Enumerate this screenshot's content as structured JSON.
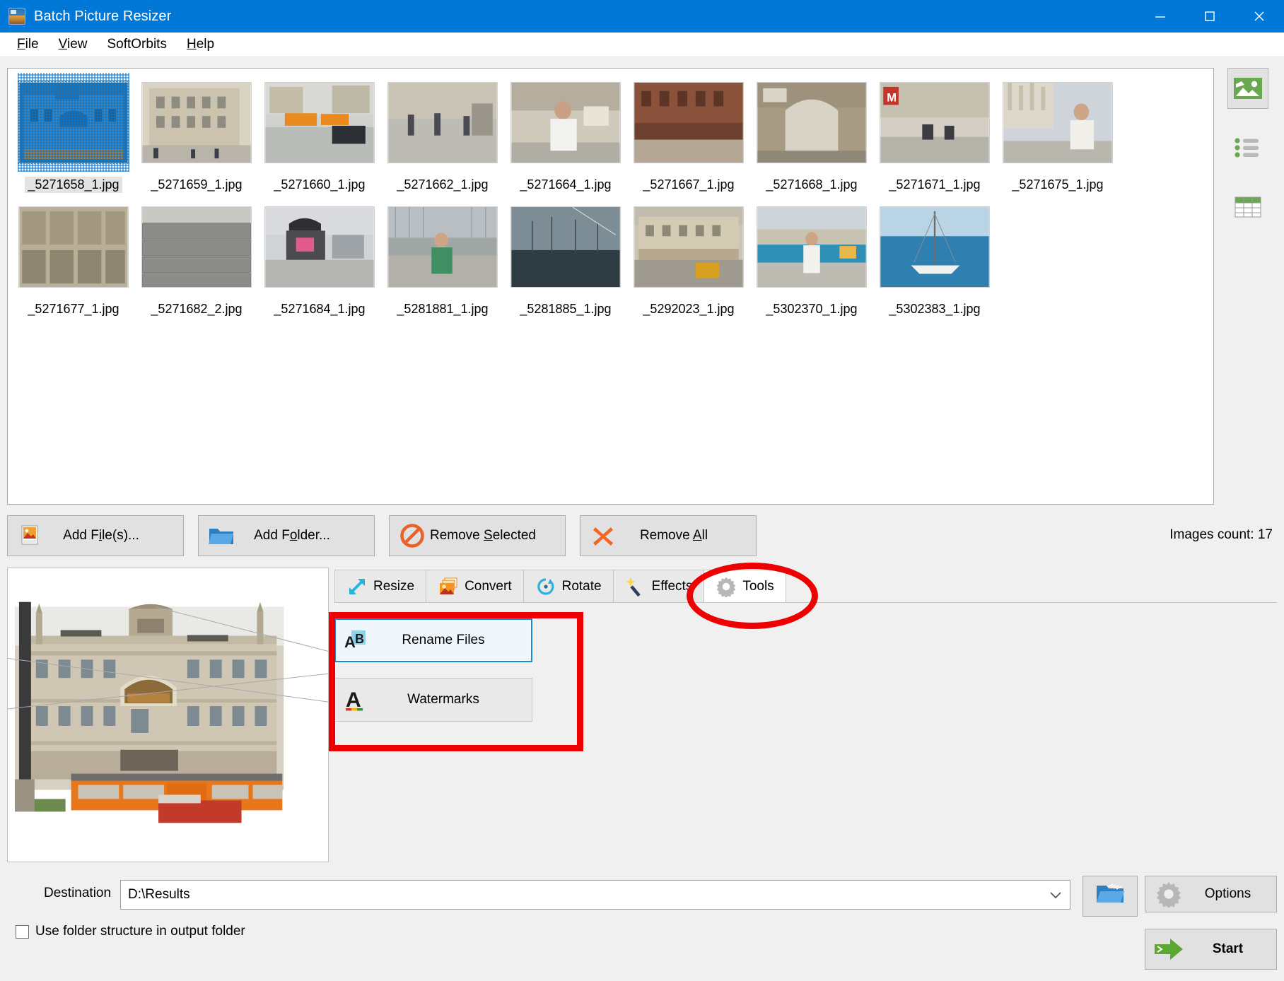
{
  "window": {
    "title": "Batch Picture Resizer",
    "icon": "app-icon",
    "controls": {
      "minimize": "–",
      "maximize": "□",
      "close": "✕"
    }
  },
  "menubar": {
    "items": [
      {
        "label": "File",
        "accel": "F"
      },
      {
        "label": "View",
        "accel": "V"
      },
      {
        "label": "SoftOrbits",
        "accel": ""
      },
      {
        "label": "Help",
        "accel": "H"
      }
    ]
  },
  "filelist": {
    "files": [
      {
        "name": "_5271658_1.jpg",
        "selected": true,
        "scene": "duomo-blue"
      },
      {
        "name": "_5271659_1.jpg",
        "selected": false,
        "scene": "corner-building"
      },
      {
        "name": "_5271660_1.jpg",
        "selected": false,
        "scene": "tram-square"
      },
      {
        "name": "_5271662_1.jpg",
        "selected": false,
        "scene": "street-people"
      },
      {
        "name": "_5271664_1.jpg",
        "selected": false,
        "scene": "man-market"
      },
      {
        "name": "_5271667_1.jpg",
        "selected": false,
        "scene": "brick-arcade"
      },
      {
        "name": "_5271668_1.jpg",
        "selected": false,
        "scene": "archway"
      },
      {
        "name": "_5271671_1.jpg",
        "selected": false,
        "scene": "metro-street"
      },
      {
        "name": "_5271675_1.jpg",
        "selected": false,
        "scene": "cathedral-man"
      },
      {
        "name": "_5271677_1.jpg",
        "selected": false,
        "scene": "stone-carving"
      },
      {
        "name": "_5271682_2.jpg",
        "selected": false,
        "scene": "grey-wall"
      },
      {
        "name": "_5271684_1.jpg",
        "selected": false,
        "scene": "car-trunk"
      },
      {
        "name": "_5281881_1.jpg",
        "selected": false,
        "scene": "harbor-man"
      },
      {
        "name": "_5281885_1.jpg",
        "selected": false,
        "scene": "dusk-masts"
      },
      {
        "name": "_5292023_1.jpg",
        "selected": false,
        "scene": "waterfront-bldg"
      },
      {
        "name": "_5302370_1.jpg",
        "selected": false,
        "scene": "promenade-woman"
      },
      {
        "name": "_5302383_1.jpg",
        "selected": false,
        "scene": "sailboat-sea"
      }
    ]
  },
  "viewmodes": {
    "items": [
      {
        "icon": "thumbnail-view-icon",
        "active": true
      },
      {
        "icon": "list-view-icon",
        "active": false
      },
      {
        "icon": "details-view-icon",
        "active": false
      }
    ]
  },
  "actions": {
    "add_files": "Add File(s)...",
    "add_files_accel": "i",
    "add_folder": "Add Folder...",
    "add_folder_accel": "o",
    "remove_selected": "Remove Selected",
    "remove_selected_accel": "S",
    "remove_all": "Remove All",
    "remove_all_accel": "A",
    "images_count": "Images count: 17"
  },
  "tabs": [
    {
      "label": "Resize",
      "icon": "resize-arrow-icon",
      "active": false
    },
    {
      "label": "Convert",
      "icon": "convert-images-icon",
      "active": false
    },
    {
      "label": "Rotate",
      "icon": "rotate-circle-icon",
      "active": false
    },
    {
      "label": "Effects",
      "icon": "magic-wand-icon",
      "active": false
    },
    {
      "label": "Tools",
      "icon": "gear-icon",
      "active": true
    }
  ],
  "tools_panel": {
    "buttons": [
      {
        "label": "Rename Files",
        "icon": "rename-ab-icon",
        "focused": true
      },
      {
        "label": "Watermarks",
        "icon": "watermark-a-icon",
        "focused": false
      }
    ]
  },
  "annotations": {
    "ellipse_target": "tools-tab",
    "rect_target": "tools-panel-buttons",
    "color": "#ef0000"
  },
  "bottom": {
    "destination_label": "Destination",
    "destination_value": "D:\\Results",
    "destination_placeholder": "D:\\Results",
    "browse_icon": "open-folder-icon",
    "options_label": "Options",
    "options_icon": "gear-icon",
    "start_label": "Start",
    "start_icon": "green-arrow-icon",
    "use_folder_structure_label": "Use folder structure in output folder",
    "use_folder_structure_checked": false
  },
  "colors": {
    "titlebar": "#0078d7",
    "accent_red": "#ef0000",
    "focus_blue": "#1d8ad2",
    "green": "#6aa84f"
  }
}
